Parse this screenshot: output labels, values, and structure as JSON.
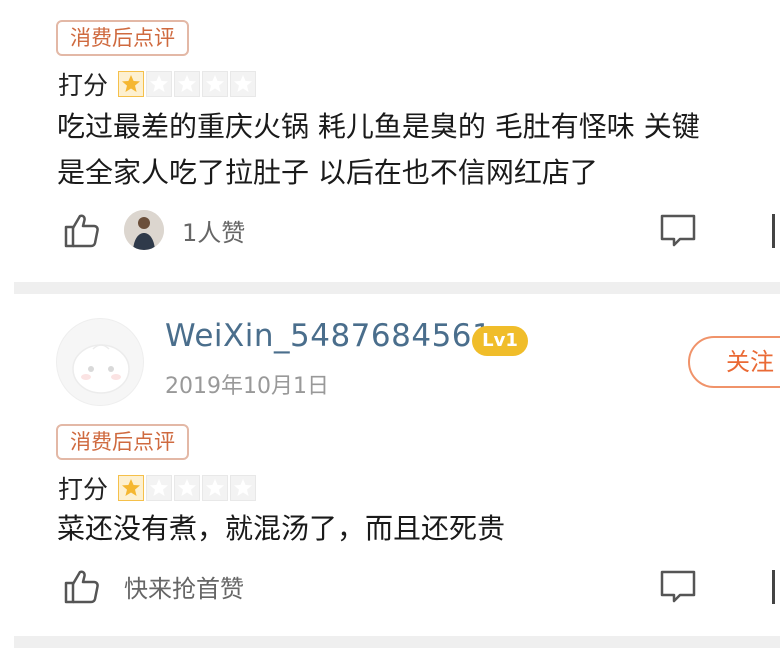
{
  "reviews": [
    {
      "tag": "消费后点评",
      "rating_label": "打分",
      "rating": 1,
      "rating_max": 5,
      "comment_lines": [
        "吃过最差的重庆火锅 耗儿鱼是臭的 毛肚有怪味 关键",
        "是全家人吃了拉肚子 以后在也不信网红店了"
      ],
      "likes_text": "1人赞"
    },
    {
      "username": "WeiXin_5487684561",
      "level": "Lv1",
      "date": "2019年10月1日",
      "follow_label": "关注",
      "tag": "消费后点评",
      "rating_label": "打分",
      "rating": 1,
      "rating_max": 5,
      "comment_lines": [
        "菜还没有煮，就混汤了，而且还死贵"
      ],
      "likes_text": "快来抢首赞"
    }
  ],
  "colors": {
    "tag_text": "#cf6a3f",
    "username": "#4a6e8c",
    "level_badge": "#f0bd2a",
    "follow": "#ea6a35",
    "star_on": "#f5c04a"
  },
  "icons": [
    "thumbs-up-icon",
    "comment-icon",
    "avatar"
  ]
}
